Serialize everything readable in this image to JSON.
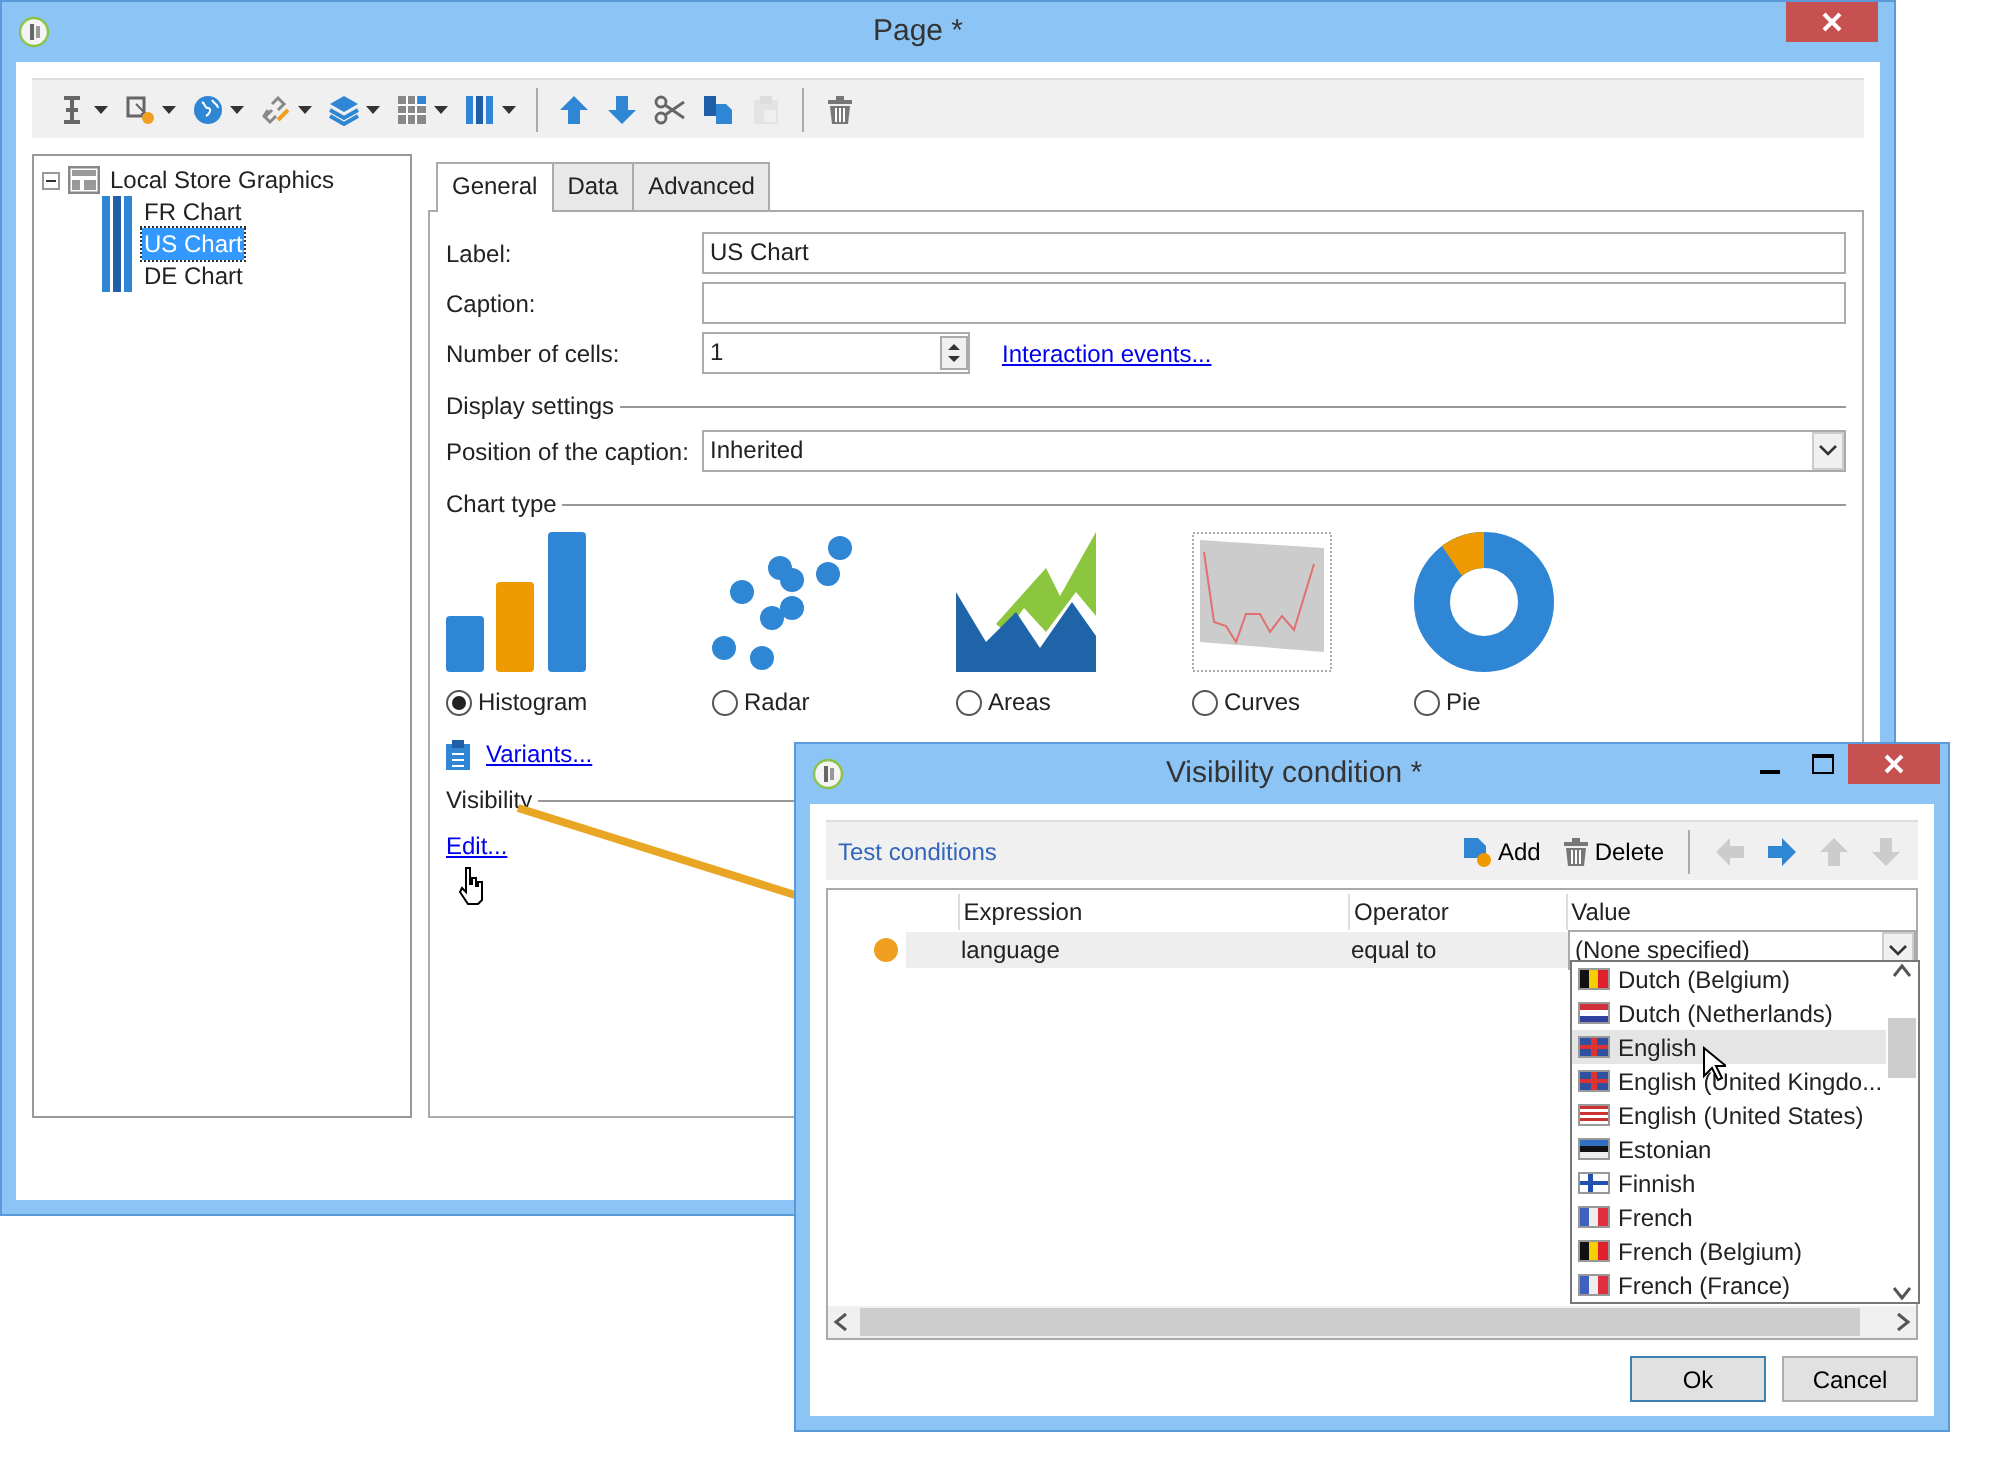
{
  "main_window": {
    "title": "Page *"
  },
  "toolbar": [
    {
      "kind": "text-cursor",
      "dropdown": true,
      "disabled": false
    },
    {
      "kind": "gear-cursor",
      "dropdown": true,
      "disabled": false
    },
    {
      "kind": "globe",
      "dropdown": true,
      "disabled": false
    },
    {
      "kind": "link",
      "dropdown": true,
      "disabled": false
    },
    {
      "kind": "layers",
      "dropdown": true,
      "disabled": false
    },
    {
      "kind": "grid",
      "dropdown": true,
      "disabled": false
    },
    {
      "kind": "columns",
      "dropdown": true,
      "disabled": false
    },
    {
      "kind": "up",
      "dropdown": false,
      "disabled": false
    },
    {
      "kind": "down",
      "dropdown": false,
      "disabled": false
    },
    {
      "kind": "cut",
      "dropdown": false,
      "disabled": false
    },
    {
      "kind": "copy",
      "dropdown": false,
      "disabled": false
    },
    {
      "kind": "paste",
      "dropdown": false,
      "disabled": true
    },
    {
      "kind": "delete",
      "dropdown": false,
      "disabled": false
    }
  ],
  "tree": [
    {
      "label": "Local Store Graphics",
      "expanded": true,
      "selected": false,
      "children": [
        {
          "label": "FR Chart",
          "selected": false
        },
        {
          "label": "US Chart",
          "selected": true
        },
        {
          "label": "DE Chart",
          "selected": false
        }
      ]
    }
  ],
  "tabs": [
    {
      "label": "General",
      "selected": true
    },
    {
      "label": "Data",
      "selected": false
    },
    {
      "label": "Advanced",
      "selected": false
    }
  ],
  "fields": [
    {
      "label": "Label:",
      "value": "US Chart"
    },
    {
      "label": "Caption:"
    }
  ],
  "cells": {
    "label": "Number of cells:",
    "value": "1",
    "link": "Interaction events..."
  },
  "display_settings": {
    "heading": "Display settings",
    "caption_position": {
      "label": "Position of the caption:",
      "value": "Inherited"
    }
  },
  "chart_type": {
    "heading": "Chart type",
    "options": [
      {
        "kind": "histogram",
        "label": "Histogram",
        "selected": true
      },
      {
        "kind": "radar",
        "label": "Radar",
        "selected": false
      },
      {
        "kind": "areas",
        "label": "Areas",
        "selected": false
      },
      {
        "kind": "curves",
        "label": "Curves",
        "selected": false
      },
      {
        "kind": "pie",
        "label": "Pie",
        "selected": false
      }
    ],
    "variants_link": "Variants..."
  },
  "visibility": {
    "heading": "Visibility",
    "edit_link": "Edit..."
  },
  "dialog": {
    "title": "Visibility condition *",
    "section": "Test conditions",
    "add": "Add",
    "delete": "Delete",
    "nav": [
      {
        "kind": "left",
        "disabled": true
      },
      {
        "kind": "right",
        "disabled": false
      },
      {
        "kind": "up",
        "disabled": true
      },
      {
        "kind": "down",
        "disabled": true
      }
    ],
    "columns": [
      "Expression",
      "Operator",
      "Value"
    ],
    "rows": [
      {
        "color": "#f0a020",
        "expression": "language",
        "operator": "equal to",
        "value": "(None specified)"
      }
    ],
    "options": [
      {
        "kind": "be",
        "label": "Dutch (Belgium)",
        "highlighted": false
      },
      {
        "kind": "nl",
        "label": "Dutch (Netherlands)",
        "highlighted": false
      },
      {
        "kind": "uk",
        "label": "English",
        "highlighted": true
      },
      {
        "kind": "uk",
        "label": "English (United Kingdo...",
        "highlighted": false
      },
      {
        "kind": "us",
        "label": "English (United States)",
        "highlighted": false
      },
      {
        "kind": "ee",
        "label": "Estonian",
        "highlighted": false
      },
      {
        "kind": "fi",
        "label": "Finnish",
        "highlighted": false
      },
      {
        "kind": "fr",
        "label": "French",
        "highlighted": false
      },
      {
        "kind": "be",
        "label": "French (Belgium)",
        "highlighted": false
      },
      {
        "kind": "fr",
        "label": "French (France)",
        "highlighted": false
      }
    ],
    "buttons": [
      "Ok",
      "Cancel"
    ]
  }
}
